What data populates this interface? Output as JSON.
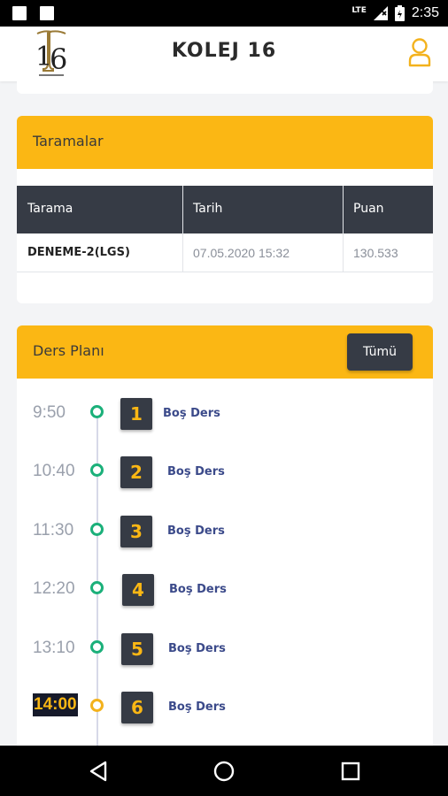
{
  "status_bar": {
    "network": "LTE",
    "time": "2:35"
  },
  "header": {
    "title": "KOLEJ 16",
    "logo_text": "16"
  },
  "taramalar": {
    "title": "Taramalar",
    "columns": [
      "Tarama",
      "Tarih",
      "Puan"
    ],
    "rows": [
      {
        "tarama": "DENEME-2(LGS)",
        "tarih": "07.05.2020 15:32",
        "puan": "130.533"
      }
    ]
  },
  "ders_plani": {
    "title": "Ders Planı",
    "all_button": "Tümü",
    "lessons": [
      {
        "time": "9:50",
        "number": "1",
        "subject": "Boş Ders",
        "active": false
      },
      {
        "time": "10:40",
        "number": "2",
        "subject": "Boş Ders",
        "active": false
      },
      {
        "time": "11:30",
        "number": "3",
        "subject": "Boş Ders",
        "active": false
      },
      {
        "time": "12:20",
        "number": "4",
        "subject": "Boş Ders",
        "active": false
      },
      {
        "time": "13:10",
        "number": "5",
        "subject": "Boş Ders",
        "active": false
      },
      {
        "time": "14:00",
        "number": "6",
        "subject": "Boş Ders",
        "active": true
      }
    ]
  },
  "colors": {
    "accent": "#fbb714",
    "dark": "#363b45",
    "dot_green": "#1bb07a",
    "subject_blue": "#3b4a8a"
  },
  "icons": {
    "user": "user-icon",
    "back": "back-triangle-icon",
    "home": "home-circle-icon",
    "recents": "recents-square-icon"
  }
}
